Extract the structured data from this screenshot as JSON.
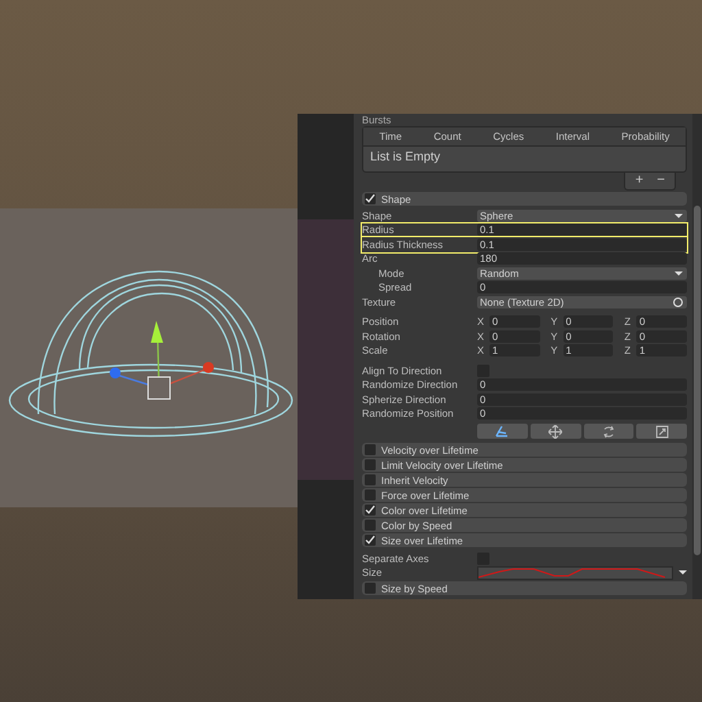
{
  "bursts": {
    "title": "Bursts",
    "columns": [
      "Time",
      "Count",
      "Cycles",
      "Interval",
      "Probability"
    ],
    "empty_text": "List is Empty",
    "add": "+",
    "remove": "−"
  },
  "shape_module": {
    "label": "Shape",
    "checked": true
  },
  "fields": [
    {
      "kind": "dropdown",
      "label": "Shape",
      "value": "Sphere",
      "highlighted": false
    },
    {
      "kind": "number",
      "label": "Radius",
      "value": "0.1",
      "highlighted": true
    },
    {
      "kind": "number",
      "label": "Radius Thickness",
      "value": "0.1",
      "highlighted": true
    },
    {
      "kind": "number",
      "label": "Arc",
      "value": "180",
      "highlighted": false,
      "children": [
        {
          "kind": "dropdown",
          "label": "Mode",
          "value": "Random",
          "highlighted": false
        },
        {
          "kind": "number",
          "label": "Spread",
          "value": "0",
          "highlighted": false
        }
      ]
    },
    {
      "kind": "object",
      "label": "Texture",
      "value": "None (Texture 2D)",
      "highlighted": false
    }
  ],
  "vectors": [
    {
      "label": "Position",
      "components": [
        {
          "axis": "X",
          "value": "0"
        },
        {
          "axis": "Y",
          "value": "0"
        },
        {
          "axis": "Z",
          "value": "0"
        }
      ]
    },
    {
      "label": "Rotation",
      "components": [
        {
          "axis": "X",
          "value": "0"
        },
        {
          "axis": "Y",
          "value": "0"
        },
        {
          "axis": "Z",
          "value": "0"
        }
      ]
    },
    {
      "label": "Scale",
      "components": [
        {
          "axis": "X",
          "value": "1"
        },
        {
          "axis": "Y",
          "value": "1"
        },
        {
          "axis": "Z",
          "value": "1"
        }
      ]
    }
  ],
  "options": [
    {
      "kind": "checkbox",
      "label": "Align To Direction",
      "checked": false
    },
    {
      "kind": "number",
      "label": "Randomize Direction",
      "value": "0"
    },
    {
      "kind": "number",
      "label": "Spherize Direction",
      "value": "0"
    },
    {
      "kind": "number",
      "label": "Randomize Position",
      "value": "0"
    }
  ],
  "modules": [
    {
      "label": "Velocity over Lifetime",
      "checked": false
    },
    {
      "label": "Limit Velocity over Lifetime",
      "checked": false
    },
    {
      "label": "Inherit Velocity",
      "checked": false
    },
    {
      "label": "Force over Lifetime",
      "checked": false
    },
    {
      "label": "Color over Lifetime",
      "checked": true
    },
    {
      "label": "Color by Speed",
      "checked": false
    },
    {
      "label": "Size over Lifetime",
      "checked": true
    }
  ],
  "size_module": {
    "separate_axes": {
      "label": "Separate Axes",
      "checked": false
    },
    "size_label": "Size"
  },
  "last_module": {
    "label": "Size by Speed",
    "checked": false
  }
}
